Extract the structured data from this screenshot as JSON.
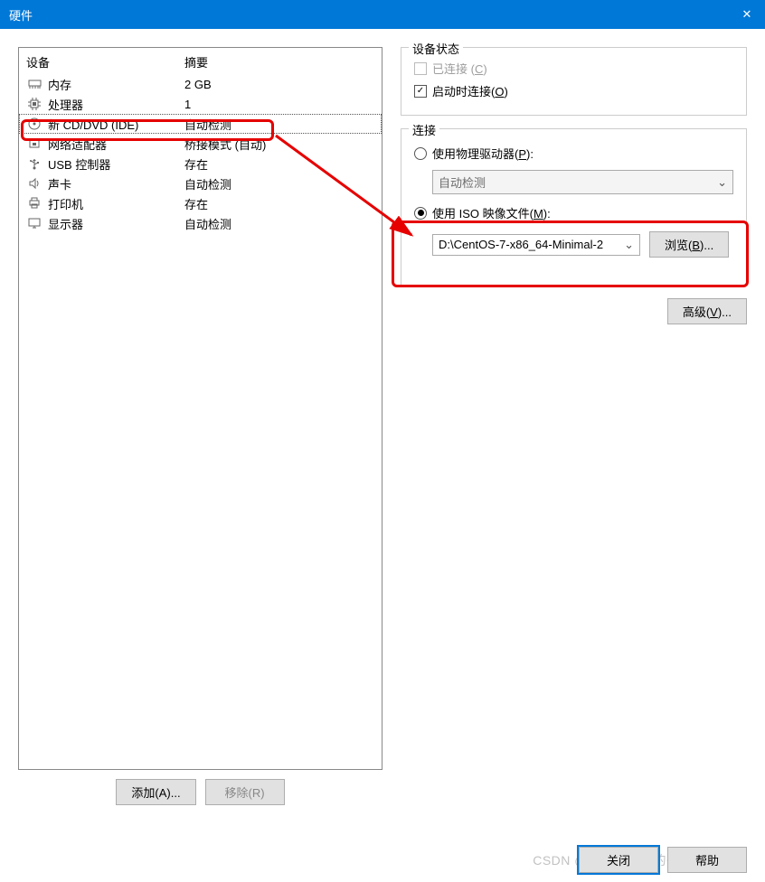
{
  "window": {
    "title": "硬件",
    "close_icon": "✕"
  },
  "device_list": {
    "header_device": "设备",
    "header_summary": "摘要",
    "rows": [
      {
        "icon": "memory",
        "name": "内存",
        "summary": "2 GB",
        "selected": false
      },
      {
        "icon": "cpu",
        "name": "处理器",
        "summary": "1",
        "selected": false
      },
      {
        "icon": "disc",
        "name": "新 CD/DVD (IDE)",
        "summary": "自动检测",
        "selected": true
      },
      {
        "icon": "net",
        "name": "网络适配器",
        "summary": "桥接模式 (自动)",
        "selected": false
      },
      {
        "icon": "usb",
        "name": "USB 控制器",
        "summary": "存在",
        "selected": false
      },
      {
        "icon": "sound",
        "name": "声卡",
        "summary": "自动检测",
        "selected": false
      },
      {
        "icon": "printer",
        "name": "打印机",
        "summary": "存在",
        "selected": false
      },
      {
        "icon": "display",
        "name": "显示器",
        "summary": "自动检测",
        "selected": false
      }
    ]
  },
  "left_buttons": {
    "add": "添加(A)...",
    "remove": "移除(R)"
  },
  "status_box": {
    "legend": "设备状态",
    "connected_label": "已连接 (C)",
    "connect_at_power_label": "启动时连接(O)"
  },
  "connection_box": {
    "legend": "连接",
    "use_physical_label": "使用物理驱动器(P):",
    "physical_value": "自动检测",
    "use_iso_label": "使用 ISO 映像文件(M):",
    "iso_value": "D:\\CentOS-7-x86_64-Minimal-2",
    "browse_label": "浏览(B)..."
  },
  "advanced_label": "高级(V)...",
  "bottom": {
    "close": "关闭",
    "help": "帮助"
  },
  "watermark": "CSDN @只想写代码的强哥"
}
